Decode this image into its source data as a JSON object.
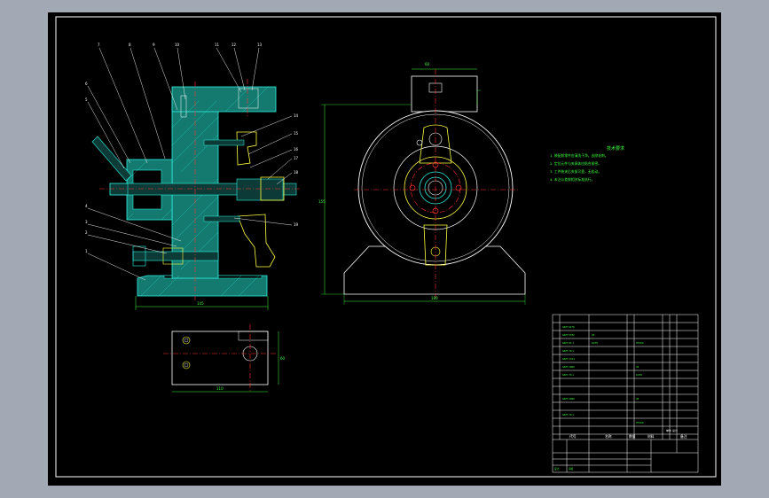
{
  "balloons_left": [
    "7",
    "8",
    "9",
    "10"
  ],
  "balloons_top": [
    "11",
    "12",
    "13"
  ],
  "balloons_mid_left": [
    "6",
    "5"
  ],
  "balloons_lower_left": [
    "4",
    "3",
    "2",
    "1"
  ],
  "balloons_right": [
    "14",
    "15",
    "16",
    "17",
    "18",
    "19"
  ],
  "technical_requirements": {
    "title": "技术要求",
    "lines": [
      "1. 装配前零件应清洗干净，去除毛刺。",
      "2. 定位元件与夹具体应贴合紧密。",
      "3. 工件装夹后夹紧可靠，无松动。",
      "4. 未注公差按相关标准执行。"
    ]
  },
  "title_block": {
    "header_code": "代号",
    "header_name": "名称",
    "header_qty": "数量",
    "header_material": "材料",
    "header_weight": "单件 总计",
    "header_remark": "备注"
  }
}
